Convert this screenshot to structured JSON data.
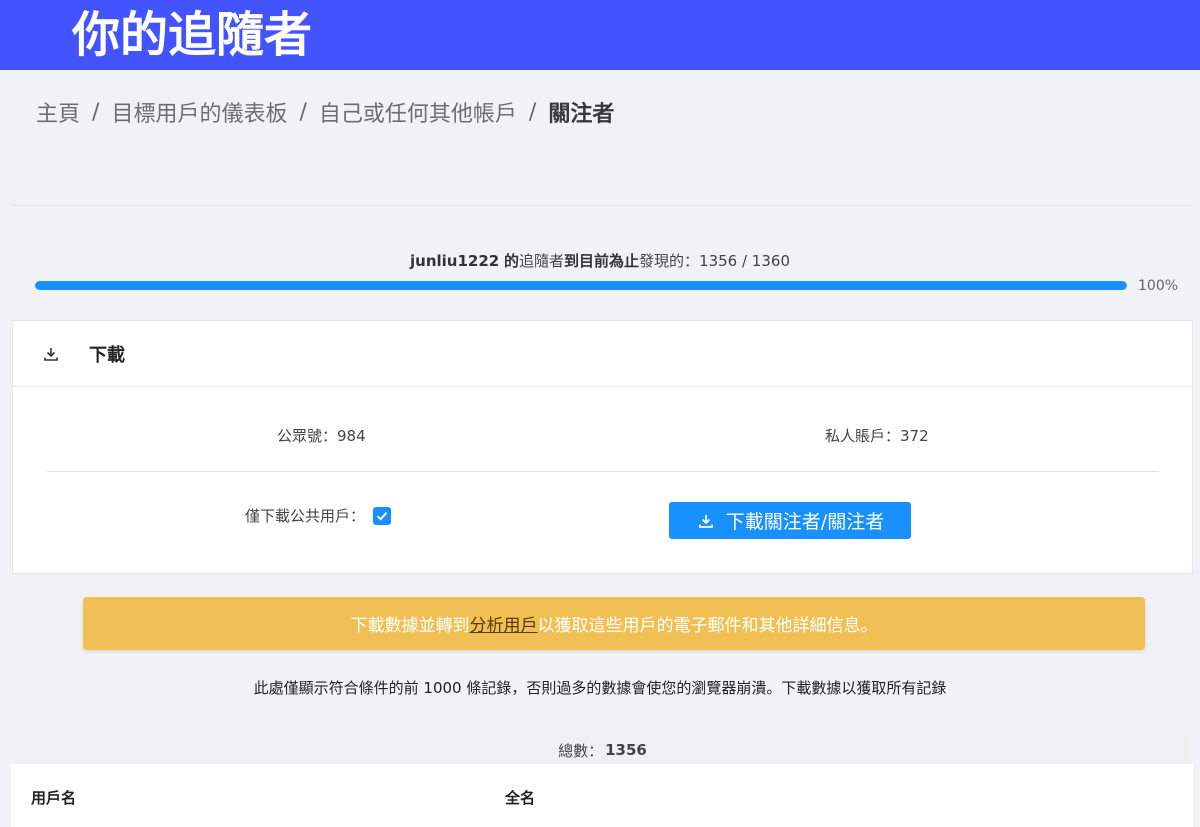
{
  "header": {
    "title": "你的追隨者"
  },
  "breadcrumb": {
    "items": [
      "主頁",
      "目標用戶的儀表板",
      "自己或任何其他帳戶"
    ],
    "separator": "/",
    "current": "關注者"
  },
  "progress": {
    "username": "junliu1222",
    "text_part1": "的",
    "text_part2": "追隨者",
    "text_part3": "到目前為止",
    "text_part4": "發現的：1356 / 1360",
    "percent_label": "100%",
    "fraction": 1.0
  },
  "download_card": {
    "title": "下載",
    "public_count_label": "公眾號：984",
    "private_count_label": "私人賬戶：372",
    "only_public_label": "僅下載公共用戶：",
    "only_public_checked": true,
    "button_label": "下載關注者/關注者"
  },
  "alert": {
    "before": "下載數據並轉到",
    "link": "分析用戶",
    "after": "以獲取這些用戶的電子郵件和其他詳細信息。"
  },
  "notice": "此處僅顯示符合條件的前 1000 條記錄，否則過多的數據會使您的瀏覽器崩潰。下載數據以獲取所有記錄",
  "total": {
    "label": "總數：",
    "value": "1356"
  },
  "table": {
    "columns": [
      "用戶名",
      "全名"
    ]
  },
  "colors": {
    "header_bg": "#4354ff",
    "primary": "#1890ff",
    "alert_bg": "#f0c055",
    "page_bg": "#f0f2f5"
  },
  "icons": [
    "download-icon",
    "checkmark-icon"
  ]
}
